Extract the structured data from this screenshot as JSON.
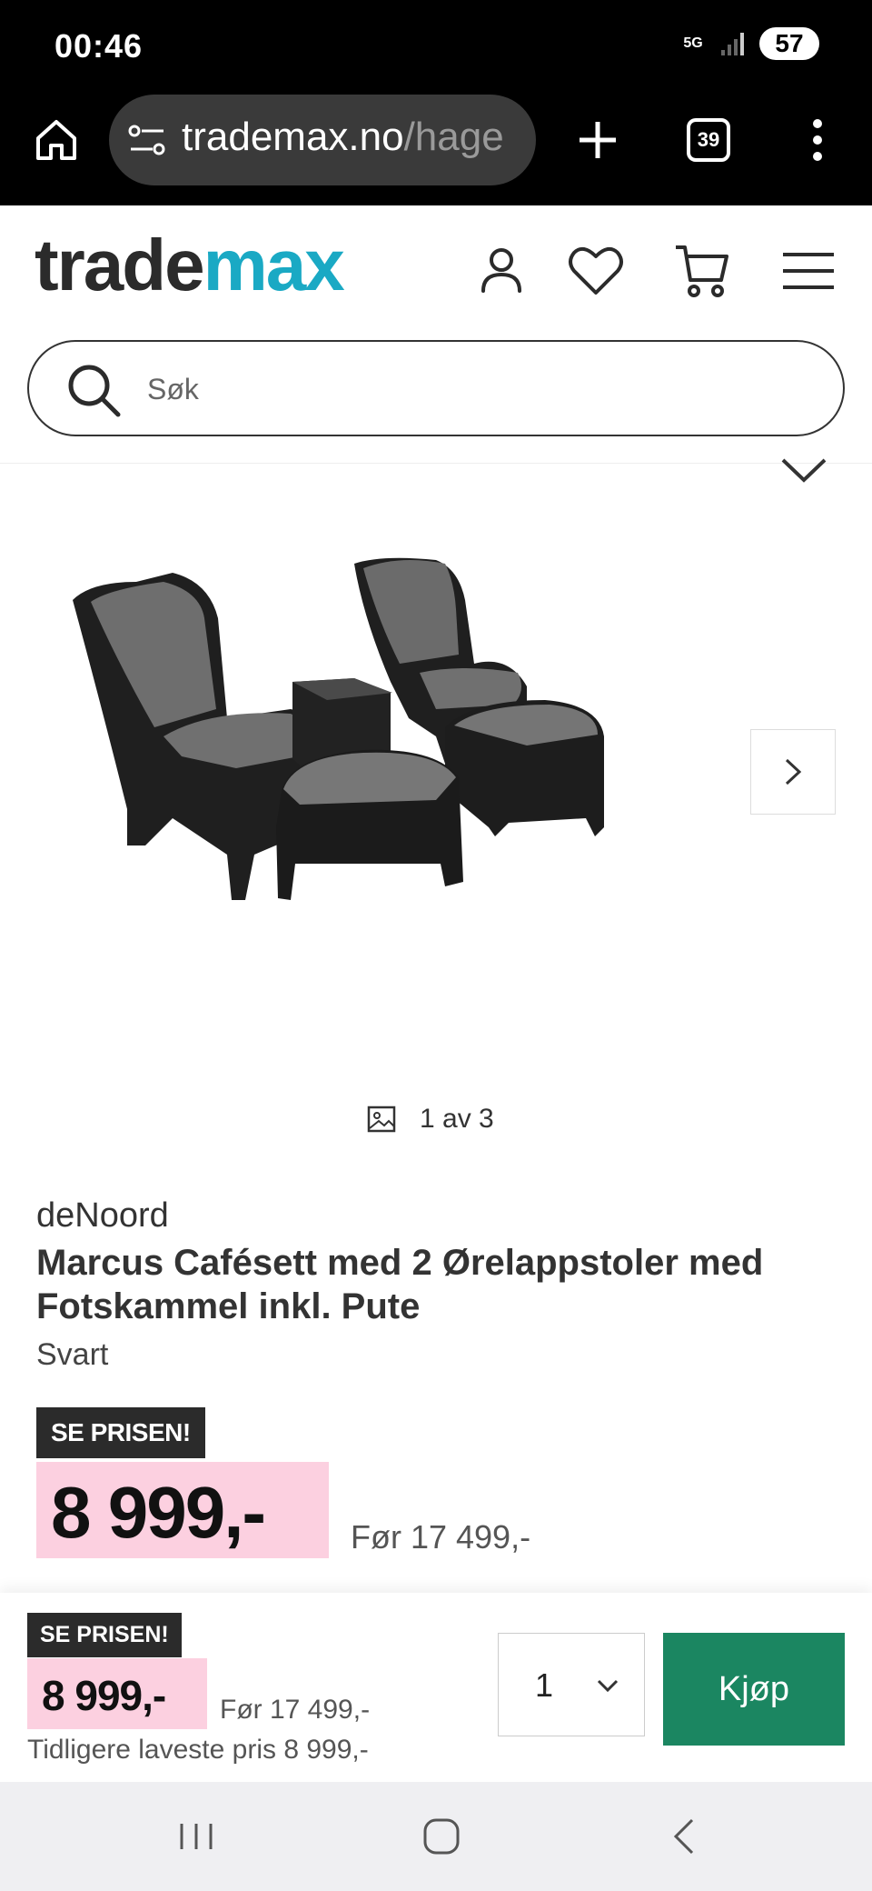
{
  "status_bar": {
    "time": "00:46",
    "network": "5G",
    "battery": "57"
  },
  "browser": {
    "url_domain": "trademax.no",
    "url_path": "/hage",
    "tab_count": "39"
  },
  "header": {
    "logo_part1": "trade",
    "logo_part2": "max",
    "search_placeholder": "Søk",
    "brand_color": "#1aa9c4"
  },
  "gallery": {
    "counter": "1 av 3"
  },
  "product": {
    "brand": "deNoord",
    "title": "Marcus Cafésett med 2 Ørelappstoler med Fotskammel inkl. Pute",
    "variant": "Svart",
    "deal_badge": "SE PRISEN!",
    "price": "8 999,-",
    "old_price": "Før 17 499,-"
  },
  "sticky_bar": {
    "deal_badge": "SE PRISEN!",
    "price": "8 999,-",
    "old_price": "Før 17 499,-",
    "lowest_price": "Tidligere laveste pris 8 999,-",
    "quantity": "1",
    "buy_label": "Kjøp",
    "buy_color": "#1b8661",
    "price_highlight_color": "#fcd0e0"
  }
}
